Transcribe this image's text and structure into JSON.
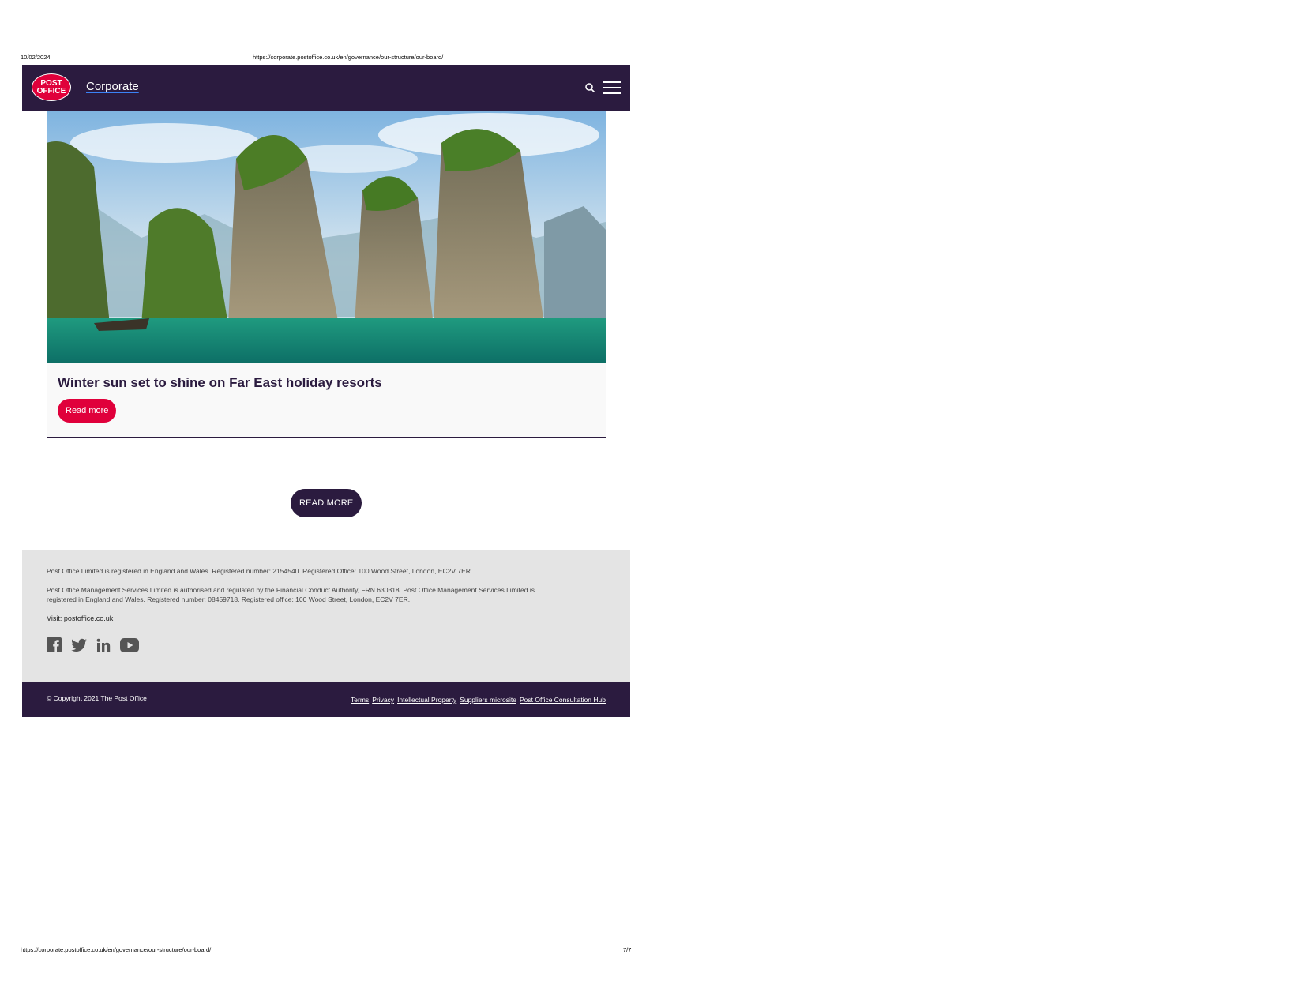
{
  "print": {
    "date": "10/02/2024",
    "url": "https://corporate.postoffice.co.uk/en/governance/our-structure/our-board/",
    "page": "7/7"
  },
  "header": {
    "logo_line1": "POST",
    "logo_line2": "OFFICE",
    "brand": "Corporate",
    "icons": [
      "search-icon",
      "menu-icon"
    ]
  },
  "card": {
    "title": "Winter sun set to shine on Far East holiday resorts",
    "button": "Read more"
  },
  "main": {
    "read_more": "READ MORE"
  },
  "footer": {
    "legal1": "Post Office Limited is registered in England and Wales. Registered number: 2154540. Registered Office: 100 Wood Street, London, EC2V 7ER.",
    "legal2": "Post Office Management Services Limited is authorised and regulated by the Financial Conduct Authority, FRN 630318. Post Office Management Services Limited is registered in England and Wales. Registered number: 08459718. Registered office: 100 Wood Street, London, EC2V 7ER.",
    "visit": "Visit: postoffice.co.uk",
    "socials": [
      "facebook-icon",
      "twitter-icon",
      "linkedin-icon",
      "youtube-icon"
    ],
    "copyright": "© Copyright 2021 The Post Office",
    "links": [
      "Terms",
      "Privacy",
      "Intellectual Property",
      "Suppliers microsite",
      "Post Office Consultation Hub"
    ]
  },
  "colors": {
    "brand_dark": "#2b1b3f",
    "brand_red": "#e0003b",
    "footer_grey": "#e4e4e4"
  }
}
